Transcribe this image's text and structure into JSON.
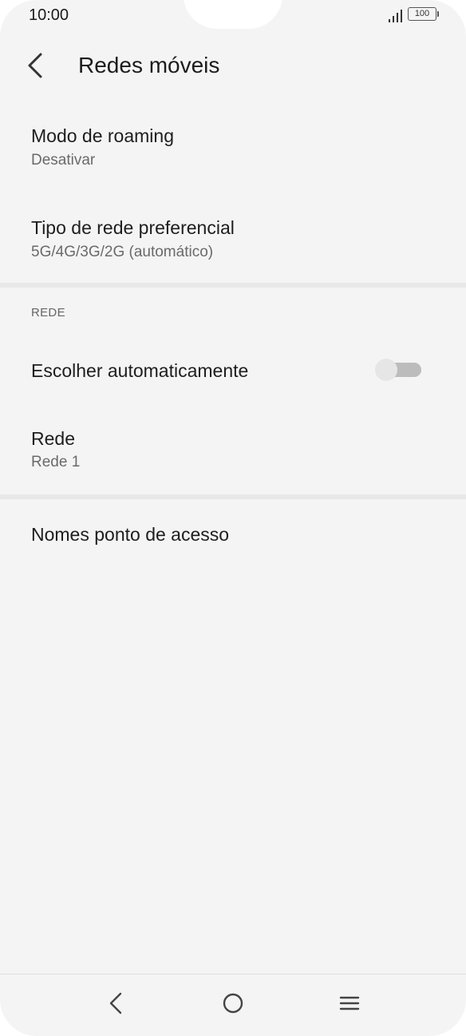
{
  "status_bar": {
    "time": "10:00",
    "battery": "100",
    "signal_icon": "signal-bars-icon"
  },
  "app_bar": {
    "title": "Redes móveis",
    "back_icon": "back-arrow-icon"
  },
  "settings": {
    "roaming": {
      "title": "Modo de roaming",
      "value": "Desativar"
    },
    "network_type": {
      "title": "Tipo de rede preferencial",
      "value": "5G/4G/3G/2G (automático)"
    },
    "section_header": "REDE",
    "auto_select": {
      "title": "Escolher automaticamente",
      "enabled": false
    },
    "network": {
      "title": "Rede",
      "value": "Rede 1"
    },
    "apn": {
      "title": "Nomes ponto de acesso"
    }
  },
  "nav_bar": {
    "back_icon": "nav-back-icon",
    "home_icon": "nav-home-icon",
    "menu_icon": "nav-menu-icon"
  }
}
